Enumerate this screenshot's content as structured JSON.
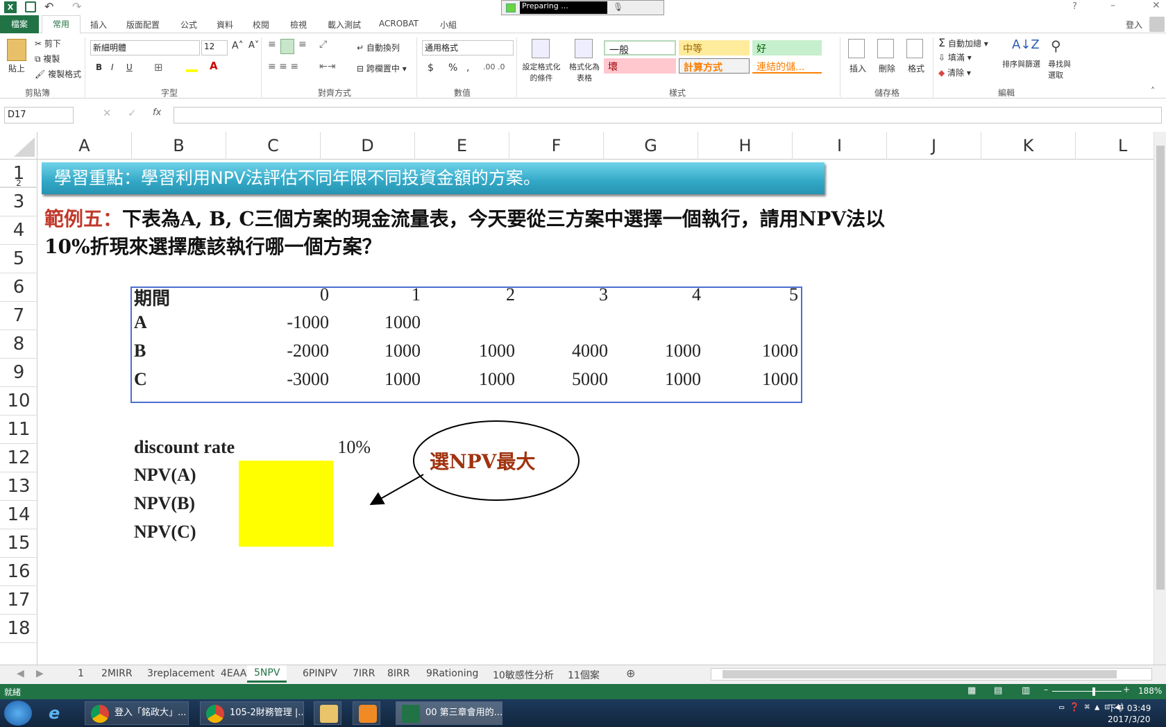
{
  "titlebar": {
    "preparing": "Preparing ...",
    "help": "?",
    "login": "登入"
  },
  "ribbon_tabs": [
    "檔案",
    "常用",
    "插入",
    "版面配置",
    "公式",
    "資料",
    "校閱",
    "檢視",
    "載入測試",
    "ACROBAT",
    "小組"
  ],
  "clipboard": {
    "paste": "貼上",
    "cut": "剪下",
    "copy": "複製",
    "format_painter": "複製格式",
    "group": "剪貼簿"
  },
  "font": {
    "name": "新細明體",
    "size": "12",
    "group": "字型",
    "bold": "B",
    "italic": "I",
    "underline": "U"
  },
  "alignment": {
    "wrap": "自動換列",
    "merge": "跨欄置中",
    "group": "對齊方式"
  },
  "number": {
    "format": "通用格式",
    "group": "數值",
    "currency": "$",
    "percent": "%",
    "comma": ","
  },
  "styles": {
    "conditional": "設定格式化的條件",
    "as_table": "格式化為表格",
    "normal": "一般",
    "neutral": "中等",
    "good": "好",
    "bad": "壞",
    "calc": "計算方式",
    "link": "連結的儲...",
    "group": "樣式"
  },
  "cells": {
    "insert": "插入",
    "delete": "刪除",
    "format": "格式",
    "group": "儲存格"
  },
  "editing": {
    "autosum": "自動加總",
    "fill": "填滿",
    "clear": "清除",
    "sort": "排序與篩選",
    "find": "尋找與選取",
    "group": "編輯"
  },
  "formula_bar": {
    "name_box": "D17",
    "fx": "fx",
    "value": ""
  },
  "columns": [
    "A",
    "B",
    "C",
    "D",
    "E",
    "F",
    "G",
    "H",
    "I",
    "J",
    "K",
    "L"
  ],
  "rows": [
    "1",
    "2",
    "3",
    "4",
    "5",
    "6",
    "7",
    "8",
    "9",
    "10",
    "11",
    "12",
    "13",
    "14",
    "15",
    "16",
    "17",
    "18"
  ],
  "sheet": {
    "banner": "學習重點：學習利用NPV法評估不同年限不同投資金額的方案。",
    "example_label": "範例五：",
    "question_line1": "下表為A, B, C三個方案的現金流量表，今天要從三方案中選擇一個執行，請用NPV法以",
    "question_line2": "10%折現來選擇應該執行哪一個方案？",
    "table": {
      "header": [
        "期間",
        "0",
        "1",
        "2",
        "3",
        "4",
        "5"
      ],
      "rows": [
        [
          "A",
          "-1000",
          "1000",
          "",
          "",
          "",
          ""
        ],
        [
          "B",
          "-2000",
          "1000",
          "1000",
          "4000",
          "1000",
          "1000"
        ],
        [
          "C",
          "-3000",
          "1000",
          "1000",
          "5000",
          "1000",
          "1000"
        ]
      ]
    },
    "discount_label": "discount rate",
    "discount_value": "10%",
    "npv_labels": [
      "NPV(A)",
      "NPV(B)",
      "NPV(C)"
    ],
    "callout": "選NPV最大"
  },
  "sheet_tabs": [
    "1",
    "2MIRR",
    "3replacement",
    "4EAA",
    "5NPV",
    "6PINPV",
    "7IRR",
    "8IRR",
    "9Rationing",
    "10敏感性分析",
    "11個案"
  ],
  "active_sheet": "5NPV",
  "status": {
    "ready": "就緒",
    "zoom": "188%"
  },
  "taskbar": {
    "items": [
      "登入「銘政大」...",
      "105-2財務管理 |...",
      "",
      "",
      "00 第三章會用的..."
    ],
    "time": "下午 03:49",
    "date": "2017/3/20"
  },
  "colors": {
    "excel_green": "#217346",
    "banner": "#3cb4d2",
    "highlight": "#ffff00",
    "table_border": "#4a6fd0",
    "example_red": "#c0392b",
    "callout_text": "#a0330f"
  }
}
